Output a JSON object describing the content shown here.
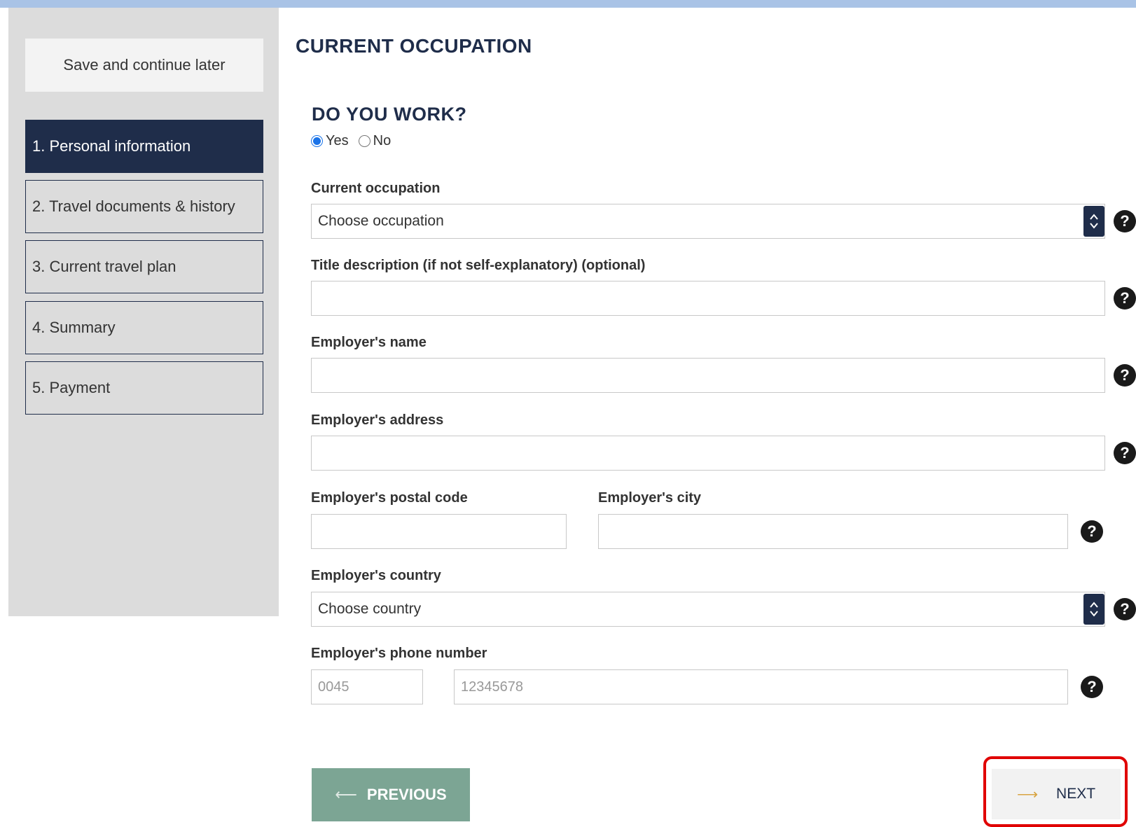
{
  "sidebar": {
    "save_label": "Save and continue later",
    "items": [
      {
        "label": "1. Personal information",
        "active": true
      },
      {
        "label": "2. Travel documents & history"
      },
      {
        "label": "3. Current travel plan"
      },
      {
        "label": "4. Summary"
      },
      {
        "label": "5. Payment"
      }
    ]
  },
  "main": {
    "section_title": "CURRENT OCCUPATION",
    "question": "DO YOU WORK?",
    "work_options": [
      {
        "label": "Yes",
        "checked": true
      },
      {
        "label": "No",
        "checked": false
      }
    ],
    "fields": {
      "occupation": {
        "label": "Current occupation",
        "value": "Choose occupation"
      },
      "title_description": {
        "label": "Title description (if not self-explanatory) (optional)",
        "value": ""
      },
      "employer_name": {
        "label": "Employer's name",
        "value": ""
      },
      "employer_address": {
        "label": "Employer's address",
        "value": ""
      },
      "employer_postal_code": {
        "label": "Employer's postal code",
        "value": ""
      },
      "employer_city": {
        "label": "Employer's city",
        "value": ""
      },
      "employer_country": {
        "label": "Employer's country",
        "value": "Choose country"
      },
      "employer_phone": {
        "label": "Employer's phone number",
        "prefix_placeholder": "0045",
        "number_placeholder": "12345678"
      }
    },
    "help_symbol": "?"
  },
  "buttons": {
    "previous": "PREVIOUS",
    "next": "NEXT"
  },
  "colors": {
    "navy": "#1f2d4a",
    "sidebar_bg": "#dcdcdc",
    "top_bar": "#a9c3e6",
    "previous_bg": "#7ca594",
    "highlight": "#e00000"
  },
  "icons": [
    "radio-icon",
    "select-arrows-icon",
    "help-icon",
    "arrow-left-icon",
    "arrow-right-icon"
  ]
}
